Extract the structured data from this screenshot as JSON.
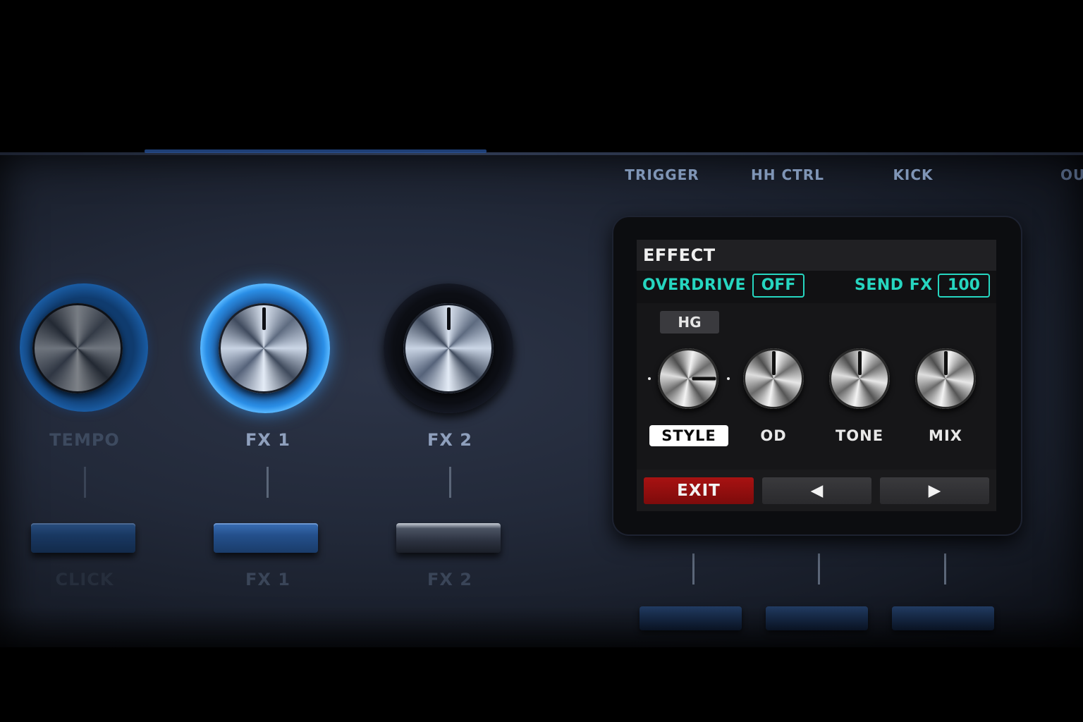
{
  "top_labels": [
    "TRIGGER",
    "HH CTRL",
    "KICK",
    "OU"
  ],
  "knobs": [
    {
      "label": "TEMPO",
      "state": "dim"
    },
    {
      "label": "FX 1",
      "state": "active"
    },
    {
      "label": "FX 2",
      "state": "off"
    }
  ],
  "pads": [
    {
      "label": "CLICK"
    },
    {
      "label": "FX 1"
    },
    {
      "label": "FX 2"
    }
  ],
  "screen": {
    "title": "EFFECT",
    "overdrive_label": "OVERDRIVE",
    "overdrive_value": "OFF",
    "send_fx_label": "SEND FX",
    "send_fx_value": "100",
    "style_badge": "HG",
    "params": [
      {
        "label": "STYLE",
        "selected": true
      },
      {
        "label": "OD",
        "selected": false
      },
      {
        "label": "TONE",
        "selected": false
      },
      {
        "label": "MIX",
        "selected": false
      }
    ],
    "exit_label": "EXIT",
    "prev_icon": "◀",
    "next_icon": "▶"
  },
  "colors": {
    "accent_teal": "#26d6c0",
    "exit_red": "#a81212",
    "knob_glow_blue": "#56b6ff"
  }
}
